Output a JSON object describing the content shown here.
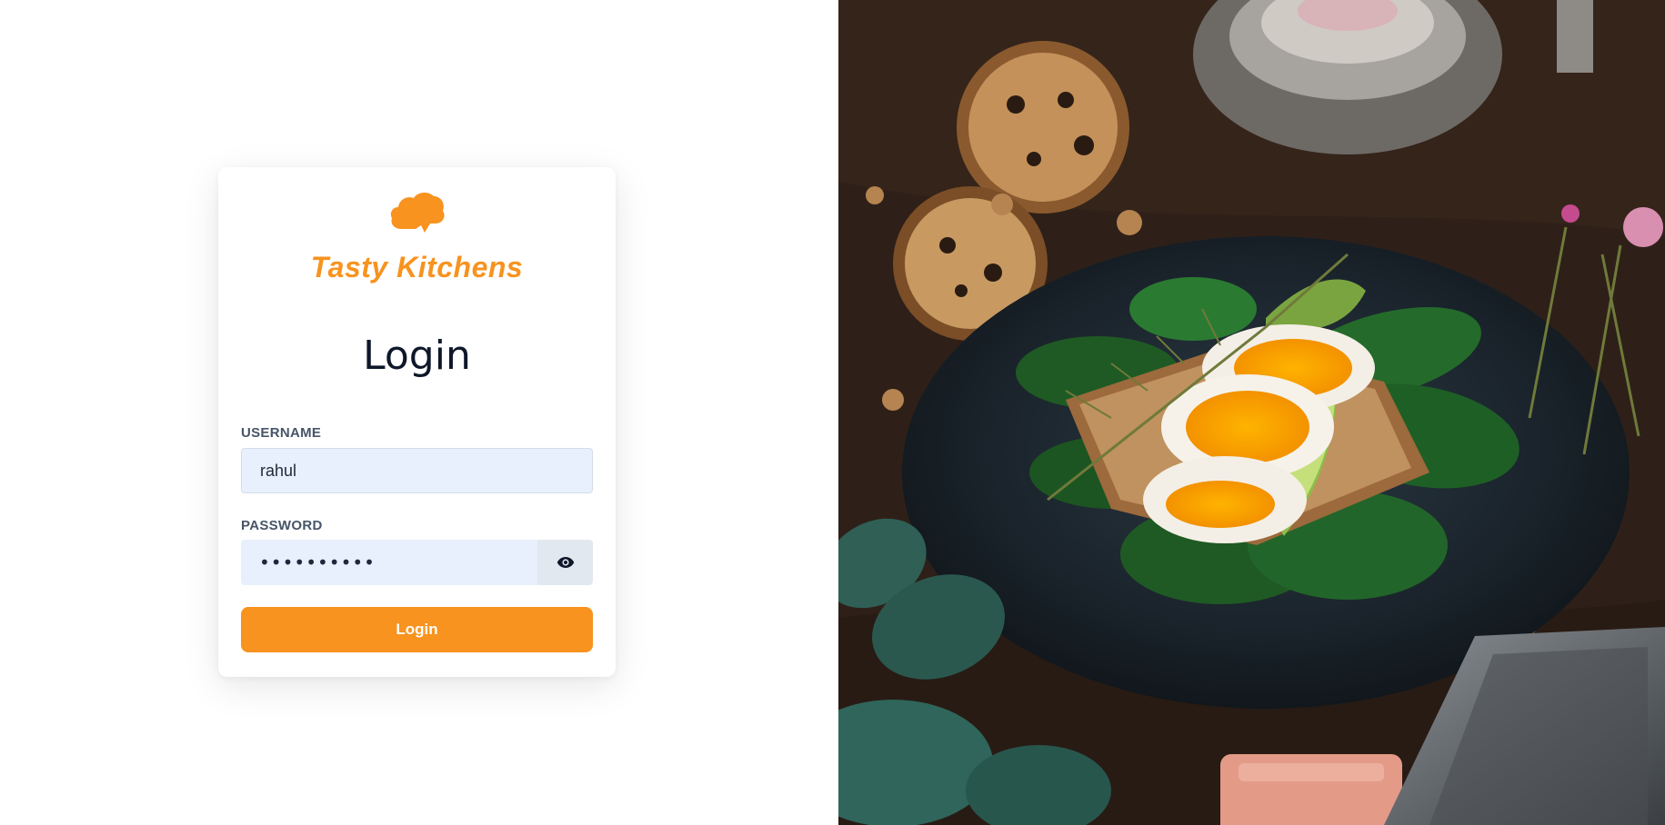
{
  "brand": {
    "name": "Tasty Kitchens",
    "accent_color": "#f7931e",
    "logo_icon": "chef-hat-icon"
  },
  "login": {
    "heading": "Login",
    "username_label": "USERNAME",
    "username_value": "rahul",
    "password_label": "PASSWORD",
    "password_value": "rahul@2021",
    "password_toggle_icon": "eye-icon",
    "submit_label": "Login"
  },
  "hero_image": {
    "subject": "food-photo"
  }
}
